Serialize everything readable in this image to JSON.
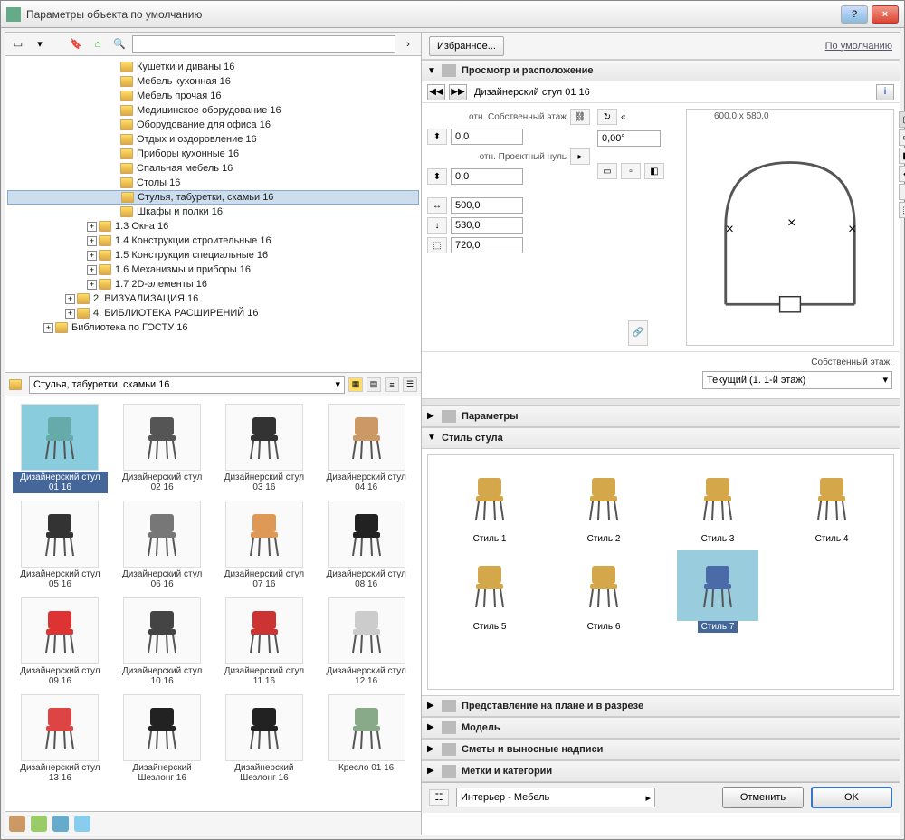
{
  "window": {
    "title": "Параметры объекта по умолчанию"
  },
  "toolbar": {
    "search_placeholder": ""
  },
  "fav_button": "Избранное...",
  "default_link": "По умолчанию",
  "tree": [
    {
      "indent": 9,
      "toggle": "",
      "label": "Кушетки и диваны 16"
    },
    {
      "indent": 9,
      "toggle": "",
      "label": "Мебель кухонная 16"
    },
    {
      "indent": 9,
      "toggle": "",
      "label": "Мебель прочая 16"
    },
    {
      "indent": 9,
      "toggle": "",
      "label": "Медицинское оборудование 16"
    },
    {
      "indent": 9,
      "toggle": "",
      "label": "Оборудование для офиса 16"
    },
    {
      "indent": 9,
      "toggle": "",
      "label": "Отдых и оздоровление 16"
    },
    {
      "indent": 9,
      "toggle": "",
      "label": "Приборы кухонные 16"
    },
    {
      "indent": 9,
      "toggle": "",
      "label": "Спальная мебель 16"
    },
    {
      "indent": 9,
      "toggle": "",
      "label": "Столы 16"
    },
    {
      "indent": 9,
      "toggle": "",
      "label": "Стулья, табуретки, скамьи 16",
      "selected": true
    },
    {
      "indent": 9,
      "toggle": "",
      "label": "Шкафы и полки 16"
    },
    {
      "indent": 7,
      "toggle": "+",
      "label": "1.3 Окна 16"
    },
    {
      "indent": 7,
      "toggle": "+",
      "label": "1.4 Конструкции строительные 16"
    },
    {
      "indent": 7,
      "toggle": "+",
      "label": "1.5 Конструкции специальные 16"
    },
    {
      "indent": 7,
      "toggle": "+",
      "label": "1.6 Механизмы и приборы 16"
    },
    {
      "indent": 7,
      "toggle": "+",
      "label": "1.7 2D-элементы 16"
    },
    {
      "indent": 5,
      "toggle": "+",
      "label": "2. ВИЗУАЛИЗАЦИЯ 16"
    },
    {
      "indent": 5,
      "toggle": "+",
      "label": "4. БИБЛИОТЕКА РАСШИРЕНИЙ 16"
    },
    {
      "indent": 3,
      "toggle": "+",
      "label": "Библиотека по ГОСТУ 16"
    }
  ],
  "folder_bar": {
    "current": "Стулья, табуретки, скамьи 16"
  },
  "thumbs": [
    {
      "label": "Дизайнерский стул 01 16",
      "selected": true,
      "color": "#6aa"
    },
    {
      "label": "Дизайнерский стул 02 16",
      "color": "#555"
    },
    {
      "label": "Дизайнерский стул 03 16",
      "color": "#333"
    },
    {
      "label": "Дизайнерский стул 04 16",
      "color": "#c96"
    },
    {
      "label": "Дизайнерский стул 05 16",
      "color": "#333"
    },
    {
      "label": "Дизайнерский стул 06 16",
      "color": "#777"
    },
    {
      "label": "Дизайнерский стул 07 16",
      "color": "#d95"
    },
    {
      "label": "Дизайнерский стул 08 16",
      "color": "#222"
    },
    {
      "label": "Дизайнерский стул 09 16",
      "color": "#d33"
    },
    {
      "label": "Дизайнерский стул 10 16",
      "color": "#444"
    },
    {
      "label": "Дизайнерский стул 11 16",
      "color": "#c33"
    },
    {
      "label": "Дизайнерский стул 12 16",
      "color": "#ccc"
    },
    {
      "label": "Дизайнерский стул 13 16",
      "color": "#d44"
    },
    {
      "label": "Дизайнерский Шезлонг 16",
      "color": "#222"
    },
    {
      "label": "Дизайнерский Шезлонг 16",
      "color": "#222"
    },
    {
      "label": "Кресло 01 16",
      "color": "#8a8"
    }
  ],
  "panels": {
    "preview": "Просмотр и расположение",
    "parameters": "Параметры",
    "chair_style": "Стиль стула",
    "plan_section": "Представление на плане и в разрезе",
    "model": "Модель",
    "listing": "Сметы и выносные надписи",
    "tags": "Метки и категории"
  },
  "nav": {
    "object_name": "Дизайнерский стул 01 16"
  },
  "preview": {
    "rel_style_label": "отн. Собственный этаж",
    "rel_project_label": "отн. Проектный нуль",
    "offset1": "0,0",
    "offset2": "0,0",
    "dim1": "500,0",
    "dim2": "530,0",
    "dim3": "720,0",
    "angle": "0,00°",
    "size_label": "600,0 x 580,0",
    "storey_label": "Собственный этаж:",
    "storey_value": "Текущий (1. 1-й этаж)"
  },
  "styles": [
    {
      "label": "Стиль 1",
      "color": "#d4a84a"
    },
    {
      "label": "Стиль 2",
      "color": "#d4a84a"
    },
    {
      "label": "Стиль 3",
      "color": "#d4a84a"
    },
    {
      "label": "Стиль 4",
      "color": "#d4a84a"
    },
    {
      "label": "Стиль 5",
      "color": "#d4a84a"
    },
    {
      "label": "Стиль 6",
      "color": "#d4a84a"
    },
    {
      "label": "Стиль 7",
      "color": "#4a6aa8",
      "selected": true
    }
  ],
  "footer": {
    "category": "Интерьер - Мебель",
    "cancel": "Отменить",
    "ok": "OK"
  }
}
